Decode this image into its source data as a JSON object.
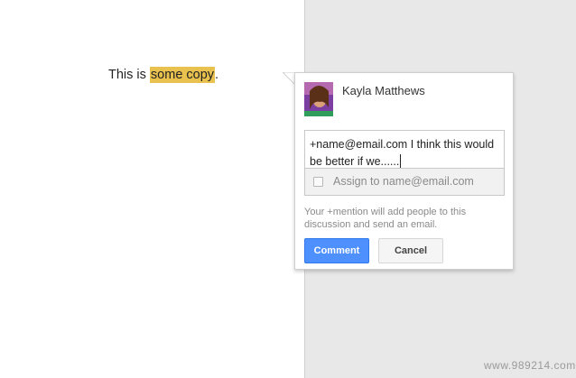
{
  "document": {
    "text_before": "This is ",
    "text_highlighted": "some copy",
    "text_after": "."
  },
  "comment": {
    "author_name": "Kayla Matthews",
    "input_text": "+name@email.com I think this would be better if we......",
    "assign_label": "Assign to name@email.com",
    "assign_checked": false,
    "hint": "Your +mention will add people to this discussion and send an email.",
    "comment_button": "Comment",
    "cancel_button": "Cancel"
  },
  "watermark": "www.989214.com",
  "colors": {
    "highlight": "#e8c14f",
    "primary_button": "#4d90fe"
  }
}
